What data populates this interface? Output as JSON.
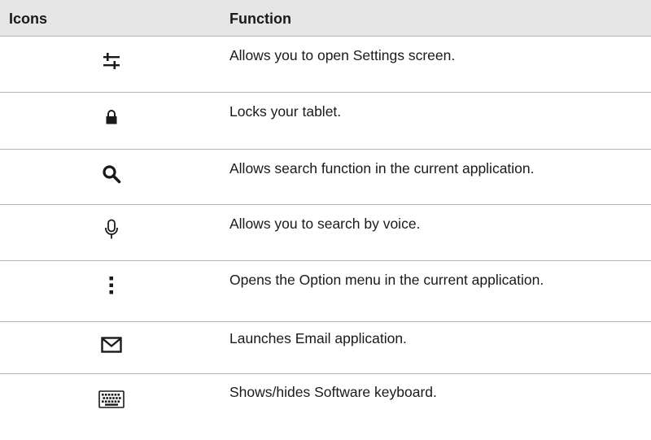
{
  "header": {
    "icons_label": "Icons",
    "function_label": "Function"
  },
  "rows": [
    {
      "icon": "settings-sliders-icon",
      "text": "Allows you to open Settings screen."
    },
    {
      "icon": "lock-icon",
      "text": "Locks your tablet."
    },
    {
      "icon": "search-icon",
      "text": "Allows search function in the current application."
    },
    {
      "icon": "microphone-icon",
      "text": "Allows you to search by voice."
    },
    {
      "icon": "overflow-menu-icon",
      "text": "Opens the Option menu in the current application."
    },
    {
      "icon": "email-icon",
      "text": "Launches Email application."
    },
    {
      "icon": "keyboard-icon",
      "text": "Shows/hides Software keyboard."
    }
  ],
  "colors": {
    "header_bg": "#e6e6e6",
    "rule": "#b5b5b5",
    "text": "#1a1a1a"
  }
}
